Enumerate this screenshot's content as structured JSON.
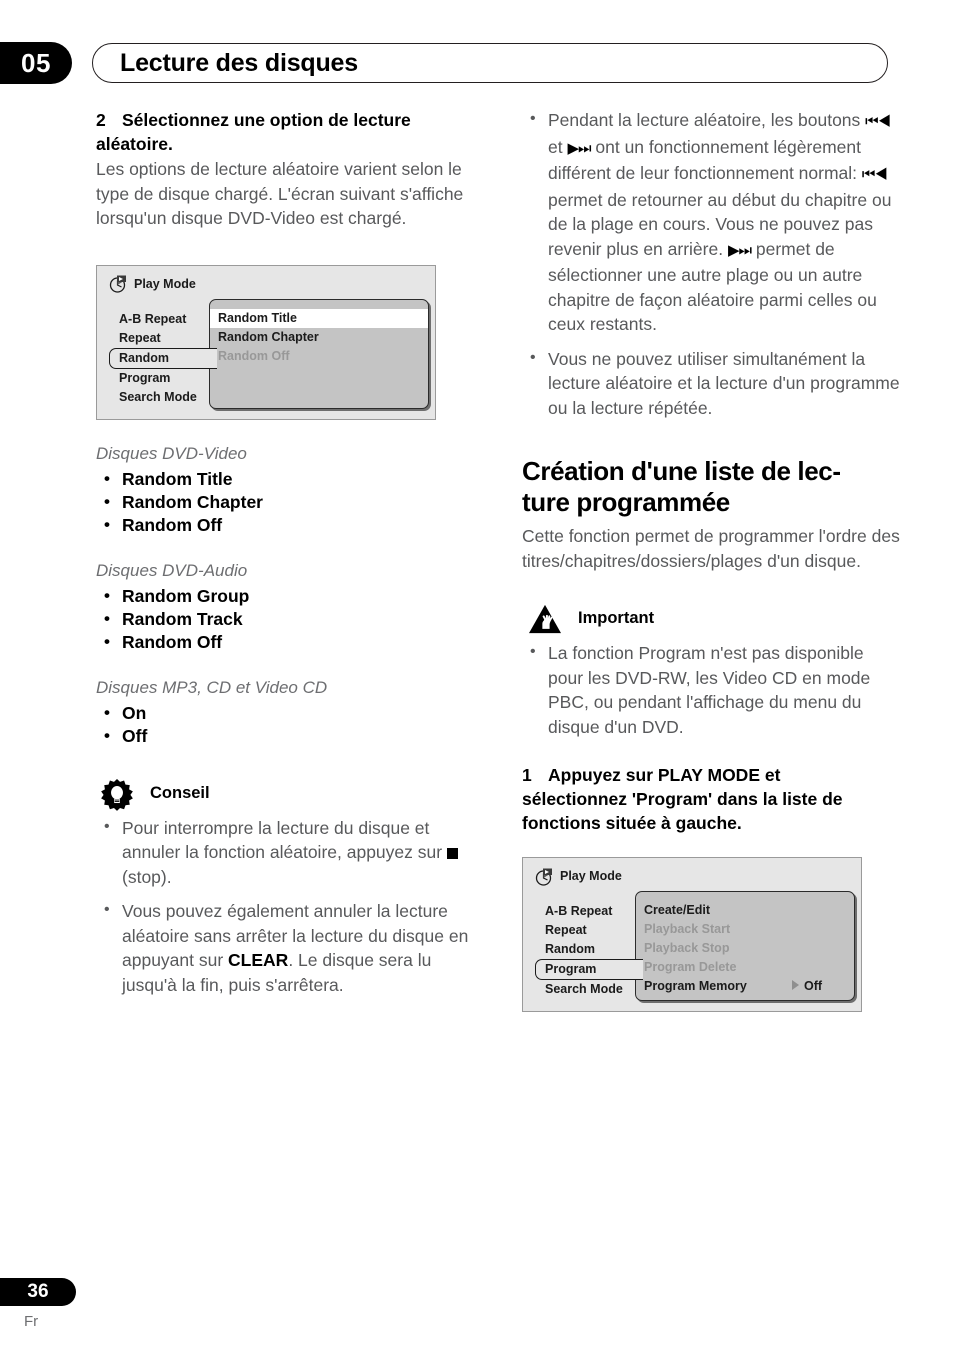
{
  "header": {
    "chapter_number": "05",
    "title": "Lecture des disques"
  },
  "footer": {
    "page_number": "36",
    "language": "Fr"
  },
  "left_column": {
    "step2": {
      "number": "2",
      "heading_line1": "Sélectionnez une option de lecture",
      "heading_line2": "aléatoire.",
      "body": "Les options de lecture aléatoire varient selon le type de disque chargé. L'écran suivant s'affiche lorsqu'un disque DVD-Video est chargé."
    },
    "osd_random": {
      "title": "Play Mode",
      "title_icon": "disc-play-icon",
      "left_items": [
        {
          "label": "A-B Repeat",
          "selected": false
        },
        {
          "label": "Repeat",
          "selected": false
        },
        {
          "label": "Random",
          "selected": true
        },
        {
          "label": "Program",
          "selected": false
        },
        {
          "label": "Search Mode",
          "selected": false
        }
      ],
      "right_items": [
        {
          "label": "Random Title",
          "state": "highlighted"
        },
        {
          "label": "Random Chapter",
          "state": "normal"
        },
        {
          "label": "Random Off",
          "state": "dimmed"
        }
      ]
    },
    "disc_groups": [
      {
        "heading": "Disques DVD-Video",
        "options": [
          "Random Title",
          "Random Chapter",
          "Random Off"
        ]
      },
      {
        "heading": "Disques DVD-Audio",
        "options": [
          "Random Group",
          "Random Track",
          "Random Off"
        ]
      },
      {
        "heading": "Disques MP3, CD et Video CD",
        "options": [
          "On",
          "Off"
        ]
      }
    ],
    "tip": {
      "icon": "lightbulb-tip-icon",
      "label": "Conseil",
      "bullets": [
        {
          "part1": "Pour interrompre la lecture du disque et annuler la fonction aléatoire, appuyez sur ",
          "symbol": "stop-square-icon",
          "part2": " (stop)."
        },
        {
          "part1": "Vous pouvez également annuler la lecture aléatoire sans arrêter la lecture du disque en appuyant sur ",
          "bold": "CLEAR",
          "part2": ". Le disque sera lu jusqu'à la fin, puis s'arrêtera."
        }
      ]
    }
  },
  "right_column": {
    "bullets": [
      {
        "seg1": "Pendant la lecture aléatoire, les boutons ",
        "icon1": "skip-back-icon",
        "seg2": " et ",
        "icon2": "skip-forward-icon",
        "seg3": " ont un fonctionnement légèrement différent de leur fonctionnement normal: ",
        "icon3": "skip-back-icon",
        "seg4": " permet de retourner au début du chapitre ou de la plage en cours. Vous ne pouvez pas revenir plus en arrière. ",
        "icon4": "skip-forward-icon",
        "seg5": " permet de sélectionner une autre plage ou un autre chapitre de façon aléatoire parmi celles ou ceux restants."
      },
      {
        "text": "Vous ne pouvez utiliser simultanément la lecture aléatoire et la lecture d'un programme ou la lecture répétée."
      }
    ],
    "section": {
      "heading_line1": "Création d'une liste de lec-",
      "heading_line2": "ture programmée",
      "body": "Cette fonction permet de programmer l'ordre des titres/chapitres/dossiers/plages d'un disque."
    },
    "important": {
      "icon": "warning-triangle-hand-icon",
      "label": "Important",
      "bullet": "La fonction Program n'est pas disponible pour les DVD-RW, les Video CD en mode PBC, ou pendant l'affichage du menu du disque d'un DVD."
    },
    "step1": {
      "number": "1",
      "heading_line1": "Appuyez sur PLAY MODE et",
      "heading_line2": "sélectionnez 'Program' dans la liste de",
      "heading_line3": "fonctions située à gauche."
    },
    "osd_program": {
      "title": "Play Mode",
      "title_icon": "disc-play-icon",
      "left_items": [
        {
          "label": "A-B Repeat",
          "selected": false
        },
        {
          "label": "Repeat",
          "selected": false
        },
        {
          "label": "Random",
          "selected": false
        },
        {
          "label": "Program",
          "selected": true
        },
        {
          "label": "Search Mode",
          "selected": false
        }
      ],
      "right_items": [
        {
          "label": "Create/Edit",
          "state": "normal",
          "value": ""
        },
        {
          "label": "Playback Start",
          "state": "dimmed",
          "value": ""
        },
        {
          "label": "Playback Stop",
          "state": "dimmed",
          "value": ""
        },
        {
          "label": "Program Delete",
          "state": "dimmed",
          "value": ""
        },
        {
          "label": "Program Memory",
          "state": "normal",
          "value": "Off"
        }
      ]
    }
  },
  "colors": {
    "text_body": "#58595b",
    "text_heading": "#000000",
    "osd_background": "#e6e6e6",
    "osd_panel": "#c4c4c4",
    "osd_highlight": "#ffffff",
    "osd_dim_text": "#989898"
  }
}
